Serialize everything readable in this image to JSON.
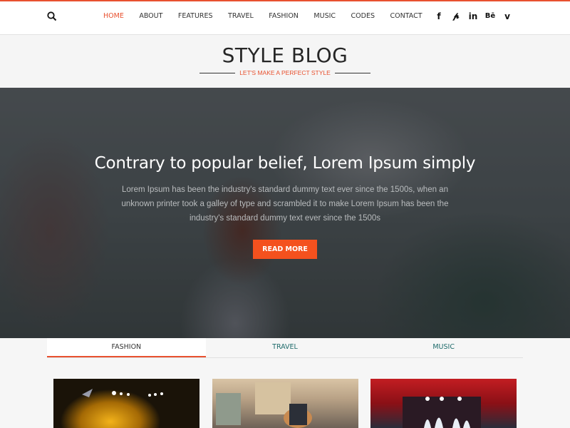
{
  "header": {
    "search_icon": "search-icon",
    "nav": [
      {
        "label": "HOME",
        "active": true
      },
      {
        "label": "ABOUT",
        "active": false
      },
      {
        "label": "FEATURES",
        "active": false
      },
      {
        "label": "TRAVEL",
        "active": false
      },
      {
        "label": "FASHION",
        "active": false
      },
      {
        "label": "MUSIC",
        "active": false
      },
      {
        "label": "CODES",
        "active": false
      },
      {
        "label": "CONTACT",
        "active": false
      }
    ],
    "social": [
      {
        "icon": "facebook-icon",
        "glyph": "f"
      },
      {
        "icon": "pinterest-icon",
        "glyph": "𝓹"
      },
      {
        "icon": "linkedin-icon",
        "glyph": "in"
      },
      {
        "icon": "behance-icon",
        "glyph": "Bē"
      },
      {
        "icon": "vimeo-icon",
        "glyph": "v"
      }
    ]
  },
  "brand": {
    "title": "STYLE BLOG",
    "tagline": "LET'S MAKE A PERFECT STYLE"
  },
  "hero": {
    "title": "Contrary to popular belief, Lorem Ipsum simply",
    "text": "Lorem Ipsum has been the industry's standard dummy text ever since the 1500s, when an unknown printer took a galley of type and scrambled it to make Lorem Ipsum has been the industry's standard dummy text ever since the 1500s",
    "button": "READ MORE"
  },
  "tabs": [
    {
      "label": "FASHION",
      "active": true
    },
    {
      "label": "TRAVEL",
      "active": false
    },
    {
      "label": "MUSIC",
      "active": false
    }
  ],
  "cards": [
    {
      "alt": "concert-stage-lights-image"
    },
    {
      "alt": "street-guitarist-image"
    },
    {
      "alt": "red-lit-stage-fountains-image"
    }
  ],
  "colors": {
    "accent": "#e8512f",
    "button": "#f4511e",
    "tab_text": "#1f6b6b"
  }
}
